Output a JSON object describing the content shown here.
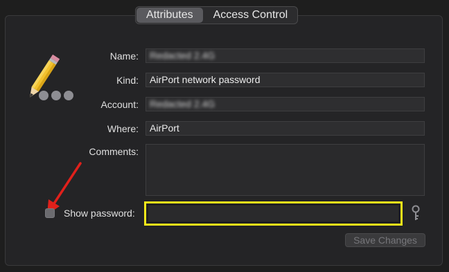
{
  "tabs": [
    {
      "label": "Attributes",
      "active": true
    },
    {
      "label": "Access Control",
      "active": false
    }
  ],
  "fields": {
    "name_label": "Name:",
    "name_value": "Redacted 2.4G",
    "kind_label": "Kind:",
    "kind_value": "AirPort network password",
    "account_label": "Account:",
    "account_value": "Redacted 2.4G",
    "where_label": "Where:",
    "where_value": "AirPort",
    "comments_label": "Comments:",
    "comments_value": ""
  },
  "password": {
    "checkbox_label": "Show password:",
    "checked": false,
    "value": ""
  },
  "buttons": {
    "save_label": "Save Changes"
  },
  "icons": {
    "item": "pencil-icon",
    "more": "ellipsis-icon",
    "key": "key-icon"
  },
  "colors": {
    "highlight": "#f5e81a",
    "annotation_arrow": "#e0201b"
  }
}
